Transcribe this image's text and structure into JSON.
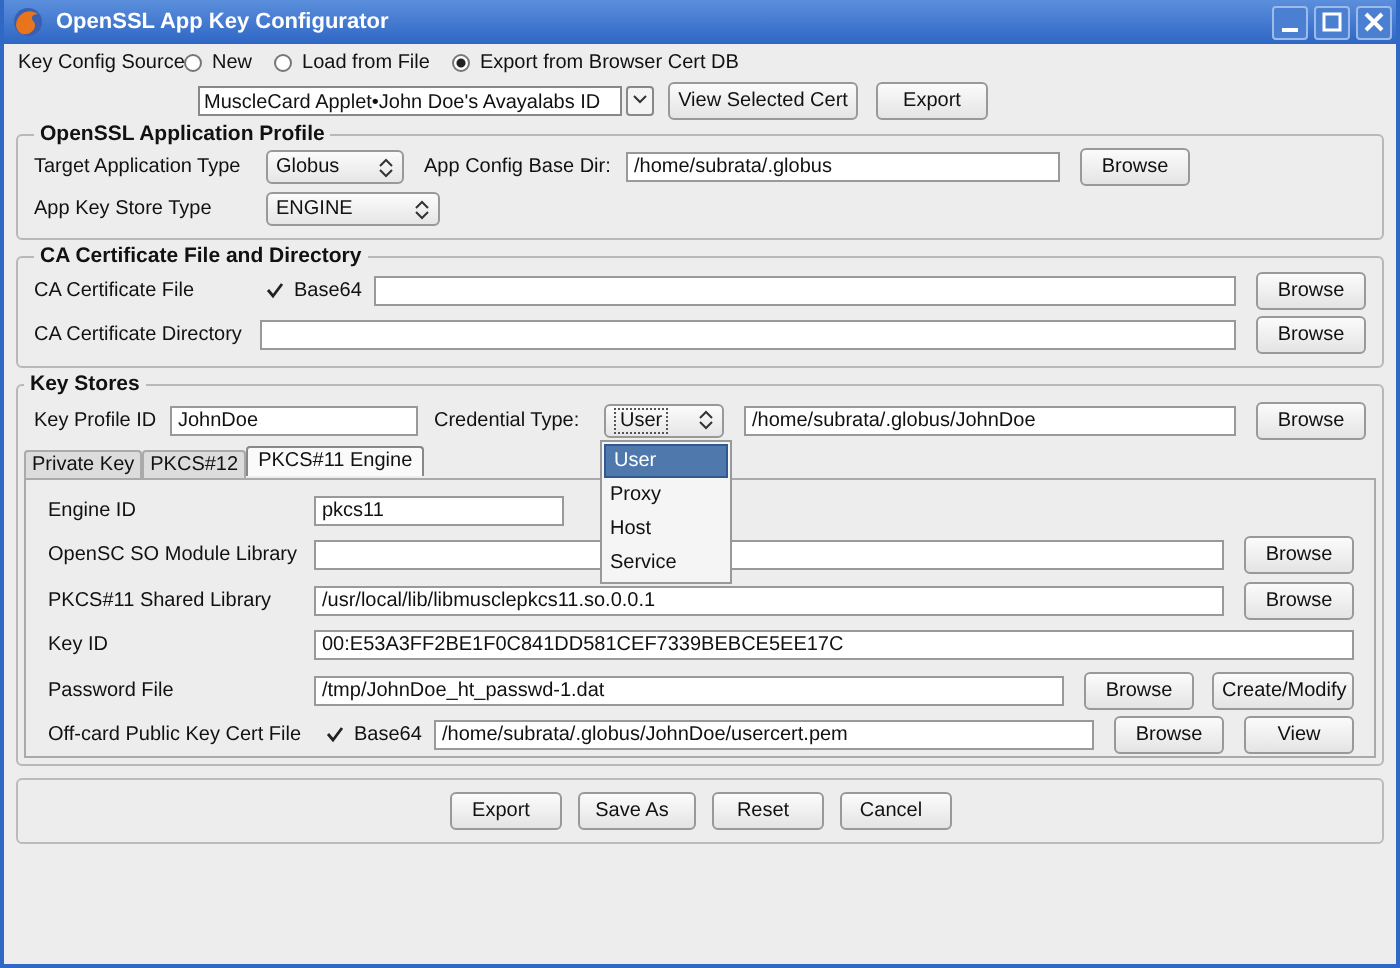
{
  "window": {
    "title": "OpenSSL App Key Configurator"
  },
  "key_config_source": {
    "label": "Key Config Source",
    "options": [
      {
        "label": "New",
        "selected": false
      },
      {
        "label": "Load from File",
        "selected": false
      },
      {
        "label": "Export from Browser Cert DB",
        "selected": true
      }
    ]
  },
  "cert_select": {
    "value": "MuscleCard Applet•John Doe's Avayalabs ID",
    "buttons": [
      "View Selected Cert",
      "Export"
    ]
  },
  "app_profile": {
    "title": "OpenSSL Application Profile",
    "target_type": {
      "label": "Target Application Type",
      "value": "Globus"
    },
    "base_dir": {
      "label": "App Config Base Dir:",
      "value": "/home/subrata/.globus",
      "button": "Browse"
    },
    "key_store_type": {
      "label": "App Key Store Type",
      "value": "ENGINE"
    }
  },
  "ca": {
    "title": "CA Certificate File and Directory",
    "file": {
      "label": "CA Certificate File",
      "checkbox": {
        "label": "Base64",
        "checked": true
      },
      "button": "Browse"
    },
    "directory": {
      "label": "CA Certificate Directory",
      "button": "Browse"
    }
  },
  "key_stores": {
    "title": "Key Stores",
    "profile_id": {
      "label": "Key Profile ID",
      "value": "JohnDoe"
    },
    "credential_type": {
      "label": "Credential Type:",
      "value": "User",
      "expanded": true,
      "options": [
        {
          "label": "User",
          "selected": true
        },
        {
          "label": "Proxy",
          "selected": false
        },
        {
          "label": "Host",
          "selected": false
        },
        {
          "label": "Service",
          "selected": false
        }
      ]
    },
    "path": {
      "value": "/home/subrata/.globus/JohnDoe",
      "button": "Browse"
    },
    "tabs": [
      {
        "label": "Private Key",
        "selected": false
      },
      {
        "label": "PKCS#12",
        "selected": false
      },
      {
        "label": "PKCS#11 Engine",
        "selected": true
      }
    ],
    "engine_fields": [
      {
        "kind": "short",
        "label": "Engine ID",
        "value": "pkcs11"
      },
      {
        "kind": "wide",
        "label": "OpenSC SO Module Library",
        "buttons": [
          "Browse"
        ]
      },
      {
        "kind": "wide",
        "label": "PKCS#11 Shared Library",
        "value": "/usr/local/lib/libmusclepkcs11.so.0.0.1",
        "buttons": [
          "Browse"
        ]
      },
      {
        "kind": "wide",
        "label": "Key ID",
        "value": "00:E53A3FF2BE1F0C841DD581CEF7339BEBCE5EE17C"
      },
      {
        "kind": "wide",
        "label": "Password File",
        "value": "/tmp/JohnDoe_ht_passwd-1.dat",
        "buttons": [
          "Browse",
          "Create/Modify"
        ]
      },
      {
        "kind": "wide",
        "label": "Off-card Public Key Cert File",
        "checkbox": {
          "label": "Base64",
          "checked": true
        },
        "value": "/home/subrata/.globus/JohnDoe/usercert.pem",
        "buttons": [
          "Browse",
          "View"
        ]
      }
    ]
  },
  "actions": [
    "Export",
    "Save As",
    "Reset",
    "Cancel"
  ]
}
